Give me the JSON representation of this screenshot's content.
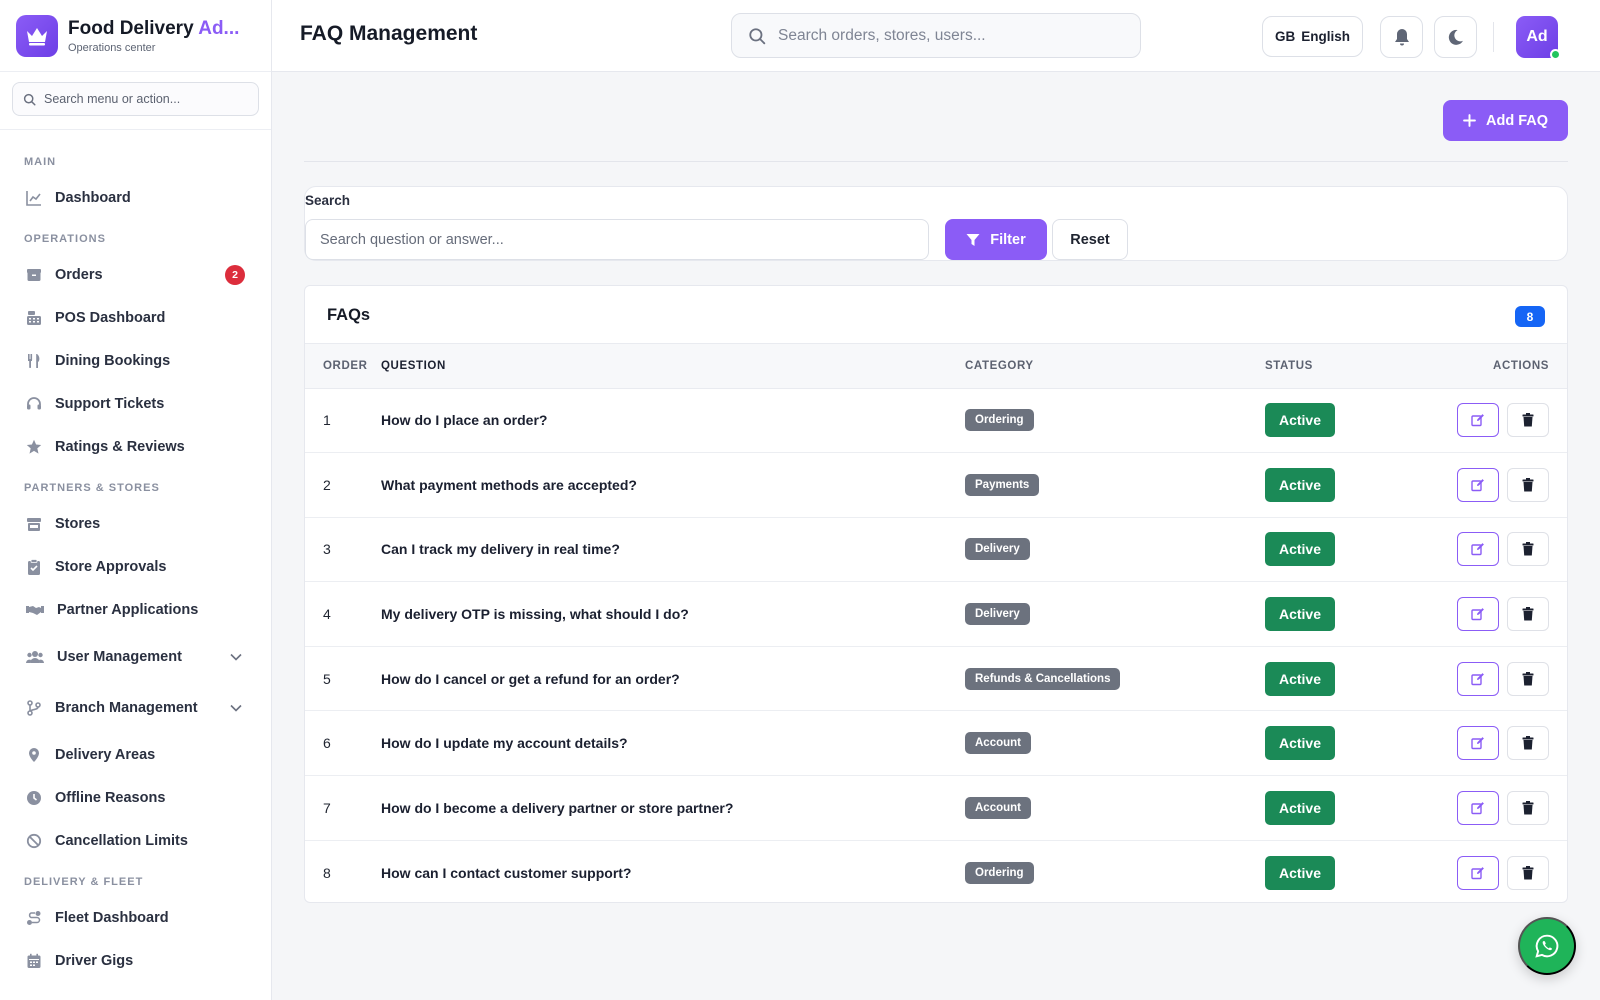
{
  "brand": {
    "title_main": "Food Delivery ",
    "title_accent": "Ad...",
    "subtitle": "Operations center"
  },
  "sidebar": {
    "search_placeholder": "Search menu or action...",
    "sections": {
      "main": "MAIN",
      "operations": "OPERATIONS",
      "partners": "PARTNERS & STORES",
      "fleet": "DELIVERY & FLEET"
    },
    "items": {
      "dashboard": "Dashboard",
      "orders": "Orders",
      "orders_badge": "2",
      "pos": "POS Dashboard",
      "dining": "Dining Bookings",
      "support": "Support Tickets",
      "ratings": "Ratings & Reviews",
      "stores": "Stores",
      "store_approvals": "Store Approvals",
      "partner_apps": "Partner Applications",
      "user_mgmt": "User Management",
      "branch_mgmt": "Branch Management",
      "delivery_areas": "Delivery Areas",
      "offline_reasons": "Offline Reasons",
      "cancel_limits": "Cancellation Limits",
      "fleet_dashboard": "Fleet Dashboard",
      "driver_gigs": "Driver Gigs"
    }
  },
  "header": {
    "title": "FAQ Management",
    "search_placeholder": "Search orders, stores, users...",
    "lang_code": "GB",
    "lang_label": "English",
    "avatar": "Ad"
  },
  "toolbar": {
    "add_label": "Add FAQ"
  },
  "filter": {
    "label": "Search",
    "placeholder": "Search question or answer...",
    "filter_label": "Filter",
    "reset_label": "Reset"
  },
  "faqs": {
    "title": "FAQs",
    "count": "8",
    "columns": {
      "order": "ORDER",
      "question": "QUESTION",
      "category": "CATEGORY",
      "status": "STATUS",
      "actions": "ACTIONS"
    },
    "rows": [
      {
        "order": "1",
        "question": "How do I place an order?",
        "category": "Ordering",
        "status": "Active"
      },
      {
        "order": "2",
        "question": "What payment methods are accepted?",
        "category": "Payments",
        "status": "Active"
      },
      {
        "order": "3",
        "question": "Can I track my delivery in real time?",
        "category": "Delivery",
        "status": "Active"
      },
      {
        "order": "4",
        "question": "My delivery OTP is missing, what should I do?",
        "category": "Delivery",
        "status": "Active"
      },
      {
        "order": "5",
        "question": "How do I cancel or get a refund for an order?",
        "category": "Refunds & Cancellations",
        "status": "Active"
      },
      {
        "order": "6",
        "question": "How do I update my account details?",
        "category": "Account",
        "status": "Active"
      },
      {
        "order": "7",
        "question": "How do I become a delivery partner or store partner?",
        "category": "Account",
        "status": "Active"
      },
      {
        "order": "8",
        "question": "How can I contact customer support?",
        "category": "Ordering",
        "status": "Active"
      }
    ]
  },
  "colors": {
    "accent": "#8b5cf6",
    "status_active": "#1b8a57",
    "category_pill": "#6c727e",
    "badge_red": "#dc2d3c",
    "count_blue": "#1565f5",
    "whatsapp": "#1fb459"
  }
}
